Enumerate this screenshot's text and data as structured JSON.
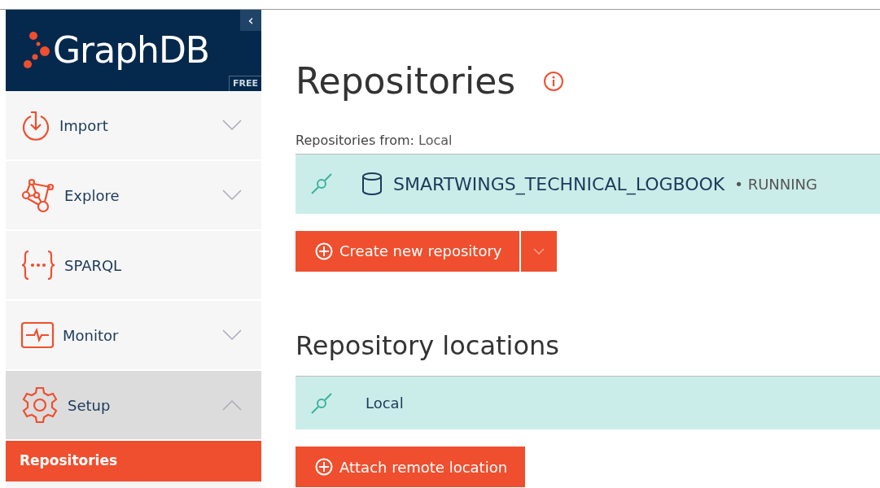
{
  "brand": {
    "name": "GraphDB",
    "edition": "FREE",
    "collapse_glyph": "‹"
  },
  "menu": [
    {
      "label": "Import",
      "kind": "group",
      "expanded": false,
      "selected": false
    },
    {
      "label": "Explore",
      "kind": "group",
      "expanded": false,
      "selected": false
    },
    {
      "label": "SPARQL",
      "kind": "link",
      "selected": false
    },
    {
      "label": "Monitor",
      "kind": "group",
      "expanded": false,
      "selected": false
    },
    {
      "label": "Setup",
      "kind": "group",
      "expanded": true,
      "selected": true,
      "children": [
        {
          "label": "Repositories",
          "selected": true
        }
      ]
    }
  ],
  "page": {
    "title": "Repositories",
    "from_label": "Repositories from:",
    "from_value": "Local",
    "repositories": [
      {
        "name": "SMARTWINGS_TECHNICAL_LOGBOOK",
        "separator": "•",
        "status": "RUNNING"
      }
    ],
    "create_button": "Create new repository",
    "locations_title": "Repository locations",
    "locations": [
      {
        "name": "Local"
      }
    ],
    "attach_button": "Attach remote location"
  }
}
